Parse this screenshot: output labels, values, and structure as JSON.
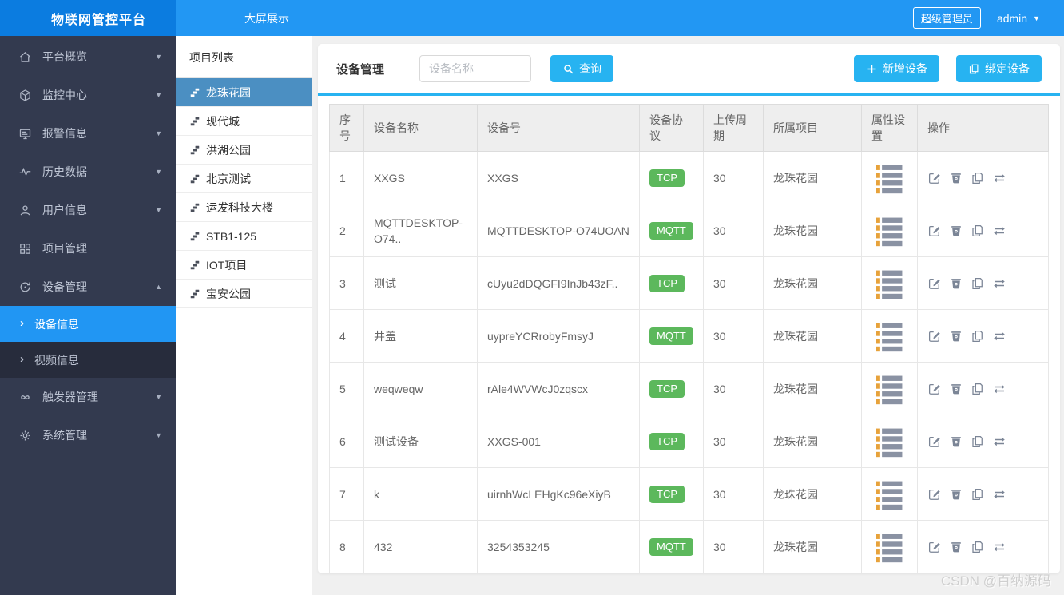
{
  "topbar": {
    "logo_title": "物联网管控平台",
    "nav": [
      {
        "label": "大屏展示"
      }
    ],
    "role_badge": "超级管理员",
    "username": "admin"
  },
  "sidebar": {
    "items": [
      {
        "label": "平台概览",
        "icon": "home-icon",
        "chevron": "down"
      },
      {
        "label": "监控中心",
        "icon": "monitor-cube-icon",
        "chevron": "down"
      },
      {
        "label": "报警信息",
        "icon": "alarm-screen-icon",
        "chevron": "down"
      },
      {
        "label": "历史数据",
        "icon": "history-pulse-icon",
        "chevron": "down"
      },
      {
        "label": "用户信息",
        "icon": "user-icon",
        "chevron": "down"
      },
      {
        "label": "项目管理",
        "icon": "project-grid-icon",
        "chevron": ""
      },
      {
        "label": "设备管理",
        "icon": "device-refresh-icon",
        "chevron": "up",
        "submenu": [
          {
            "label": "设备信息",
            "active": true
          },
          {
            "label": "视频信息",
            "active": false
          }
        ]
      },
      {
        "label": "触发器管理",
        "icon": "trigger-infinity-icon",
        "chevron": "down"
      },
      {
        "label": "系统管理",
        "icon": "gear-icon",
        "chevron": "down"
      }
    ]
  },
  "project_panel": {
    "title": "项目列表",
    "items": [
      {
        "label": "龙珠花园",
        "selected": true
      },
      {
        "label": "现代城",
        "selected": false
      },
      {
        "label": "洪湖公园",
        "selected": false
      },
      {
        "label": "北京测试",
        "selected": false
      },
      {
        "label": "运发科技大楼",
        "selected": false
      },
      {
        "label": "STB1-125",
        "selected": false
      },
      {
        "label": "IOT项目",
        "selected": false
      },
      {
        "label": "宝安公园",
        "selected": false
      }
    ]
  },
  "main": {
    "title": "设备管理",
    "search_placeholder": "设备名称",
    "search_button": "查询",
    "add_button": "新增设备",
    "bind_button": "绑定设备",
    "table": {
      "headers": [
        "序号",
        "设备名称",
        "设备号",
        "设备协议",
        "上传周期",
        "所属项目",
        "属性设置",
        "操作"
      ],
      "rows": [
        {
          "no": "1",
          "name": "XXGS",
          "device_id": "XXGS",
          "protocol": "TCP",
          "period": "30",
          "project": "龙珠花园"
        },
        {
          "no": "2",
          "name": "MQTTDESKTOP-O74..",
          "device_id": "MQTTDESKTOP-O74UOAN",
          "protocol": "MQTT",
          "period": "30",
          "project": "龙珠花园"
        },
        {
          "no": "3",
          "name": "测试",
          "device_id": "cUyu2dDQGFI9InJb43zF..",
          "protocol": "TCP",
          "period": "30",
          "project": "龙珠花园"
        },
        {
          "no": "4",
          "name": "井盖",
          "device_id": "uypreYCRrobyFmsyJ",
          "protocol": "MQTT",
          "period": "30",
          "project": "龙珠花园"
        },
        {
          "no": "5",
          "name": "weqweqw",
          "device_id": "rAle4WVWcJ0zqscx",
          "protocol": "TCP",
          "period": "30",
          "project": "龙珠花园"
        },
        {
          "no": "6",
          "name": "测试设备",
          "device_id": "XXGS-001",
          "protocol": "TCP",
          "period": "30",
          "project": "龙珠花园"
        },
        {
          "no": "7",
          "name": "k",
          "device_id": "uirnhWcLEHgKc96eXiyB",
          "protocol": "TCP",
          "period": "30",
          "project": "龙珠花园"
        },
        {
          "no": "8",
          "name": "432",
          "device_id": "3254353245",
          "protocol": "MQTT",
          "period": "30",
          "project": "龙珠花园"
        }
      ]
    }
  },
  "watermark": "CSDN @百纳源码",
  "colors": {
    "topbar": "#2297f3",
    "logo_bg": "#0b7ce0",
    "sidebar_bg": "#333a4f",
    "submenu_bg": "#272c3c",
    "active_blue": "#2196f3",
    "project_selected": "#4b8fc2",
    "button_blue": "#27b3f1",
    "badge_green": "#5cb85c"
  }
}
